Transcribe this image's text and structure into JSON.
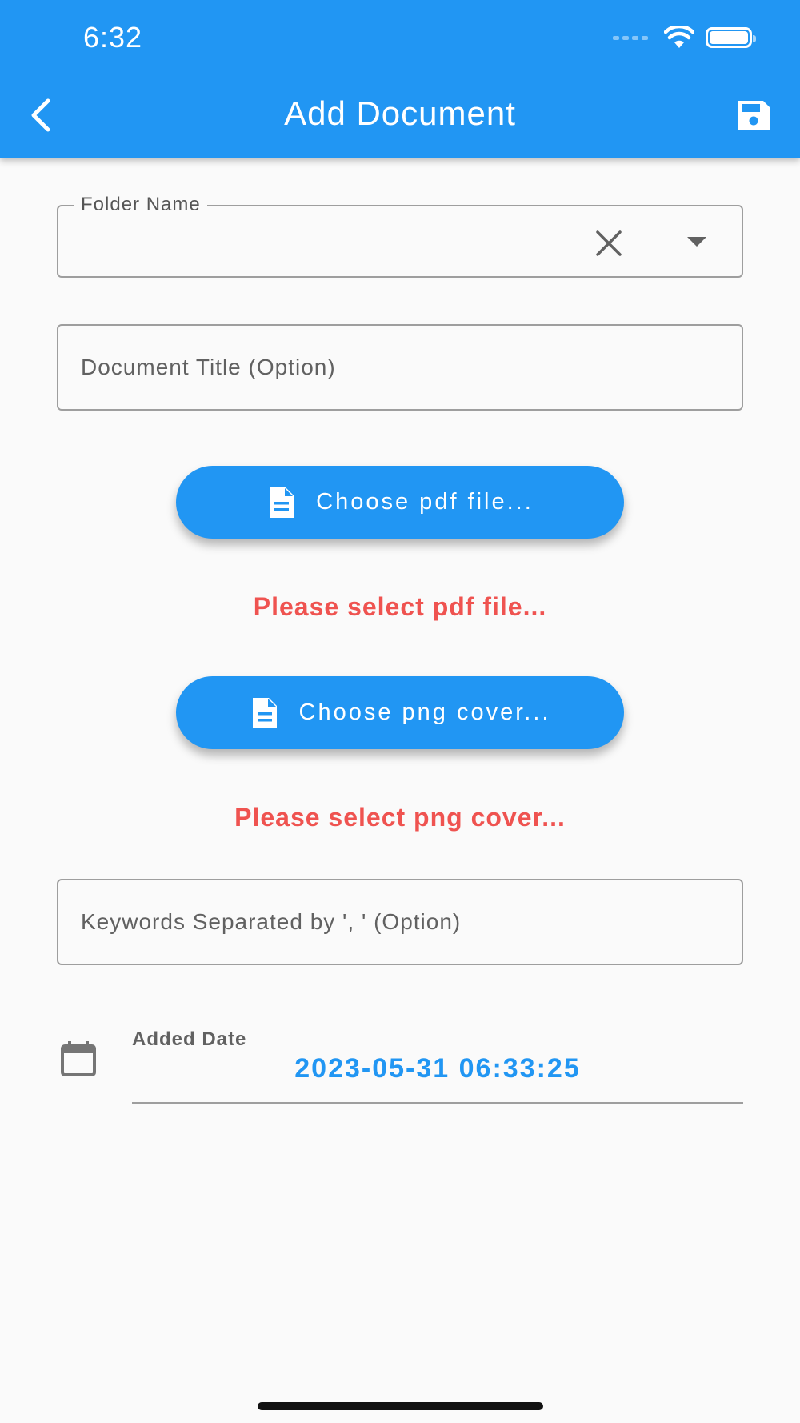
{
  "status_bar": {
    "time": "6:32"
  },
  "header": {
    "title": "Add Document"
  },
  "form": {
    "folder_name": {
      "label": "Folder Name",
      "value": ""
    },
    "document_title": {
      "placeholder": "Document Title (Option)",
      "value": ""
    },
    "choose_pdf": {
      "label": "Choose pdf file...",
      "error": "Please select pdf file..."
    },
    "choose_png": {
      "label": "Choose png cover...",
      "error": "Please select png cover..."
    },
    "keywords": {
      "placeholder": "Keywords Separated by ', ' (Option)",
      "value": ""
    },
    "added_date": {
      "label": "Added Date",
      "value": "2023-05-31 06:33:25"
    }
  },
  "colors": {
    "primary": "#2196f3",
    "error": "#ef5350",
    "background": "#fafafa"
  }
}
